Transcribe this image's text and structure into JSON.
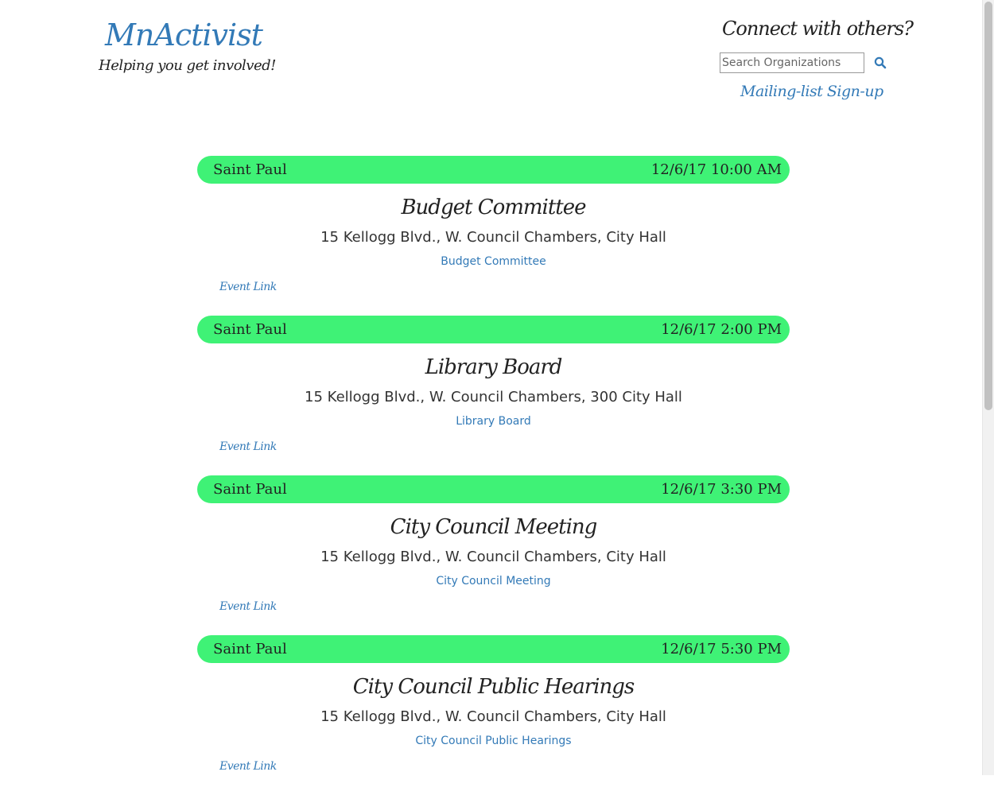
{
  "brand": {
    "name": "MnActivist",
    "tagline": "Helping you get involved!"
  },
  "connect": {
    "heading": "Connect with others?",
    "search_placeholder": "Search Organizations",
    "search_icon": "search-icon",
    "mailing_label": "Mailing-list Sign-up"
  },
  "colors": {
    "accent": "#337ab7",
    "event_bar": "#3ff276",
    "text": "#222222"
  },
  "events": [
    {
      "city": "Saint Paul",
      "datetime": "12/6/17 10:00 AM",
      "title": "Budget Committee",
      "address": "15 Kellogg Blvd., W. Council Chambers, City Hall",
      "org": "Budget Committee",
      "link_label": "Event Link"
    },
    {
      "city": "Saint Paul",
      "datetime": "12/6/17 2:00 PM",
      "title": "Library Board",
      "address": "15 Kellogg Blvd., W. Council Chambers, 300 City Hall",
      "org": "Library Board",
      "link_label": "Event Link"
    },
    {
      "city": "Saint Paul",
      "datetime": "12/6/17 3:30 PM",
      "title": "City Council Meeting",
      "address": "15 Kellogg Blvd., W. Council Chambers, City Hall",
      "org": "City Council Meeting",
      "link_label": "Event Link"
    },
    {
      "city": "Saint Paul",
      "datetime": "12/6/17 5:30 PM",
      "title": "City Council Public Hearings",
      "address": "15 Kellogg Blvd., W. Council Chambers, City Hall",
      "org": "City Council Public Hearings",
      "link_label": "Event Link"
    }
  ]
}
